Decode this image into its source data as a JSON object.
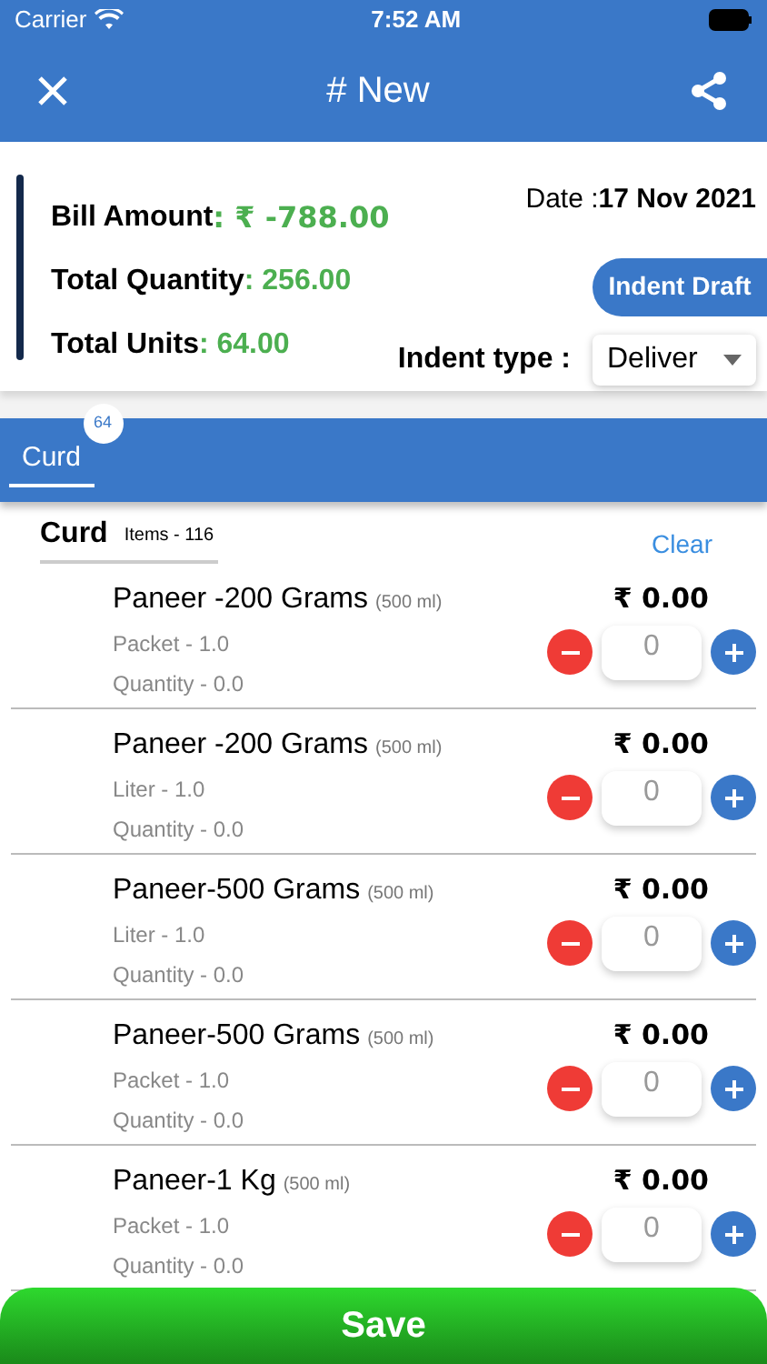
{
  "status_bar": {
    "carrier": "Carrier",
    "time": "7:52 AM"
  },
  "header": {
    "title": "# New"
  },
  "summary": {
    "bill_amount_label": "Bill Amount",
    "bill_amount": ": ₹ -788.00",
    "total_quantity_label": "Total Quantity",
    "total_quantity": ": 256.00",
    "total_units_label": "Total Units",
    "total_units": ": 64.00",
    "date_label": "Date :",
    "date": "17 Nov 2021",
    "indent_draft_button": "Indent Draft",
    "indent_type_label": "Indent type :",
    "indent_type_value": "Deliver"
  },
  "tabs": [
    {
      "label": "Curd",
      "badge": "64",
      "selected": true
    }
  ],
  "section": {
    "title": "Curd",
    "items_count": "Items - 116",
    "clear": "Clear"
  },
  "products": [
    {
      "name": "Paneer -200 Grams",
      "size": "(500 ml)",
      "unit": "Packet - 1.0",
      "quantity": "Quantity - 0.0",
      "price": "₹ 0.00",
      "count": "0"
    },
    {
      "name": "Paneer -200 Grams",
      "size": "(500 ml)",
      "unit": "Liter - 1.0",
      "quantity": "Quantity - 0.0",
      "price": "₹ 0.00",
      "count": "0"
    },
    {
      "name": "Paneer-500 Grams",
      "size": "(500 ml)",
      "unit": "Liter - 1.0",
      "quantity": "Quantity - 0.0",
      "price": "₹ 0.00",
      "count": "0"
    },
    {
      "name": "Paneer-500 Grams",
      "size": "(500 ml)",
      "unit": "Packet - 1.0",
      "quantity": "Quantity - 0.0",
      "price": "₹ 0.00",
      "count": "0"
    },
    {
      "name": "Paneer-1 Kg",
      "size": "(500 ml)",
      "unit": "Packet - 1.0",
      "quantity": "Quantity - 0.0",
      "price": "₹ 0.00",
      "count": "0"
    }
  ],
  "save_button": "Save"
}
